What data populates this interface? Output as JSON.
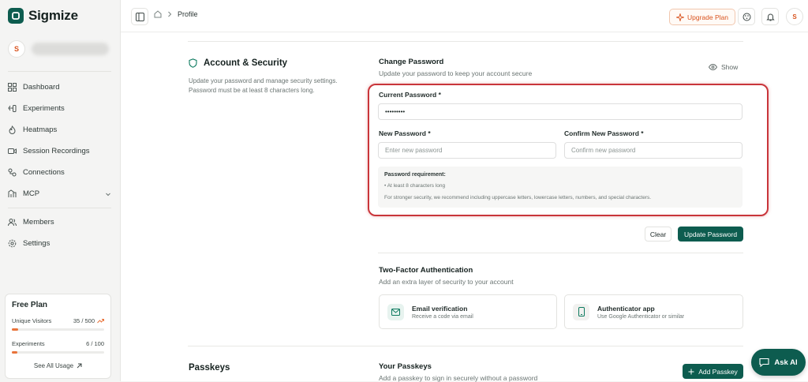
{
  "brand": {
    "name": "Sigmize"
  },
  "user": {
    "avatar_initial": "S"
  },
  "sidebar": {
    "items": [
      {
        "label": "Dashboard",
        "icon": "dashboard-icon"
      },
      {
        "label": "Experiments",
        "icon": "experiments-icon"
      },
      {
        "label": "Heatmaps",
        "icon": "heatmaps-icon"
      },
      {
        "label": "Session Recordings",
        "icon": "recordings-icon"
      },
      {
        "label": "Connections",
        "icon": "connections-icon"
      },
      {
        "label": "MCP",
        "icon": "mcp-icon"
      },
      {
        "label": "Members",
        "icon": "members-icon"
      },
      {
        "label": "Settings",
        "icon": "settings-icon"
      }
    ]
  },
  "plan": {
    "title": "Free Plan",
    "visitors_label": "Unique Visitors",
    "visitors_value": "35 / 500",
    "visitors_fraction": 0.07,
    "experiments_label": "Experiments",
    "experiments_value": "6 / 100",
    "experiments_fraction": 0.06,
    "link": "See All Usage"
  },
  "header": {
    "breadcrumb": "Profile",
    "upgrade_label": "Upgrade Plan",
    "avatar_initial": "S"
  },
  "security": {
    "title": "Account & Security",
    "desc": "Update your password and manage security settings. Password must be at least 8 characters long."
  },
  "password": {
    "title": "Change Password",
    "subtitle": "Update your password to keep your account secure",
    "show_label": "Show",
    "current_label": "Current Password *",
    "current_value": "•••••••••",
    "new_label": "New Password *",
    "new_placeholder": "Enter new password",
    "confirm_label": "Confirm New Password *",
    "confirm_placeholder": "Confirm new password",
    "req_title": "Password requirement:",
    "req_item": "• At least 8 characters long",
    "req_note": "For stronger security, we recommend including uppercase letters, lowercase letters, numbers, and special characters.",
    "clear_label": "Clear",
    "update_label": "Update Password"
  },
  "twofa": {
    "title": "Two-Factor Authentication",
    "subtitle": "Add an extra layer of security to your account",
    "email_title": "Email verification",
    "email_sub": "Receive a code via email",
    "app_title": "Authenticator app",
    "app_sub": "Use Google Authenticator or similar"
  },
  "passkeys": {
    "section_title": "Passkeys",
    "title": "Your Passkeys",
    "subtitle": "Add a passkey to sign in securely without a password",
    "add_label": "Add Passkey"
  },
  "ask_ai": {
    "label": "Ask AI"
  },
  "colors": {
    "accent": "#0d5c4f",
    "orange": "#d9531e",
    "highlight": "#c9353a"
  }
}
